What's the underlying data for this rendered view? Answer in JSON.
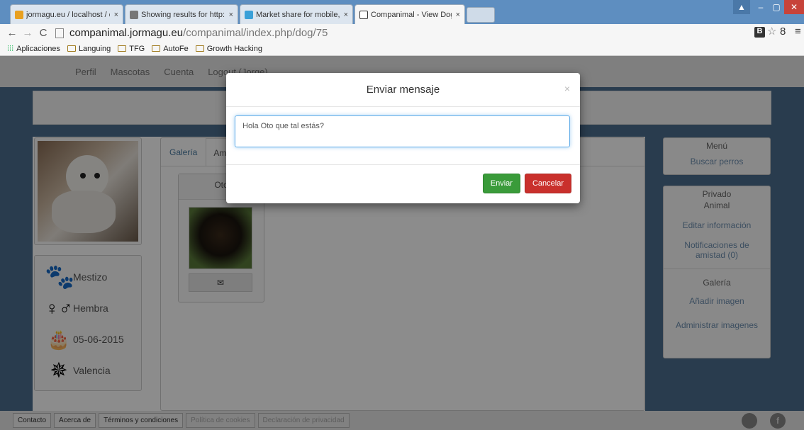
{
  "browser": {
    "tabs": [
      {
        "title": "jormagu.eu / localhost / c",
        "active": false
      },
      {
        "title": "Showing results for http:/",
        "active": false
      },
      {
        "title": "Market share for mobile, l",
        "active": false
      },
      {
        "title": "Companimal - View Dog",
        "active": true
      }
    ],
    "url_host": "companimal.jormagu.eu",
    "url_path": "/companimal/index.php/dog/75",
    "bookmarks": [
      "Aplicaciones",
      "Languing",
      "TFG",
      "AutoFe",
      "Growth Hacking"
    ]
  },
  "page": {
    "nav": [
      "Perfil",
      "Mascotas",
      "Cuenta",
      "Logout (Jorge)"
    ],
    "tabs": [
      "Galería",
      "Am"
    ],
    "friend_label": "Oto",
    "dog_info": {
      "breed": "Mestizo",
      "sex": "Hembra",
      "birthdate": "05-06-2015",
      "city": "Valencia"
    },
    "sidebar_menu": {
      "title": "Menú",
      "items": [
        "Buscar perros"
      ]
    },
    "sidebar_private": {
      "title": "Privado",
      "subtitle": "Animal",
      "items": [
        "Editar información",
        "Notificaciones de amistad (0)"
      ],
      "gallery_title": "Galería",
      "gallery_items": [
        "Añadir imagen",
        "Administrar imagenes"
      ]
    },
    "footer": [
      "Contacto",
      "Acerca de",
      "Términos y condiciones",
      "Política de cookies",
      "Declaración de privacidad"
    ]
  },
  "modal": {
    "title": "Enviar mensaje",
    "close": "×",
    "message": "Hola Oto que tal estás?",
    "send_label": "Enviar",
    "cancel_label": "Cancelar"
  }
}
